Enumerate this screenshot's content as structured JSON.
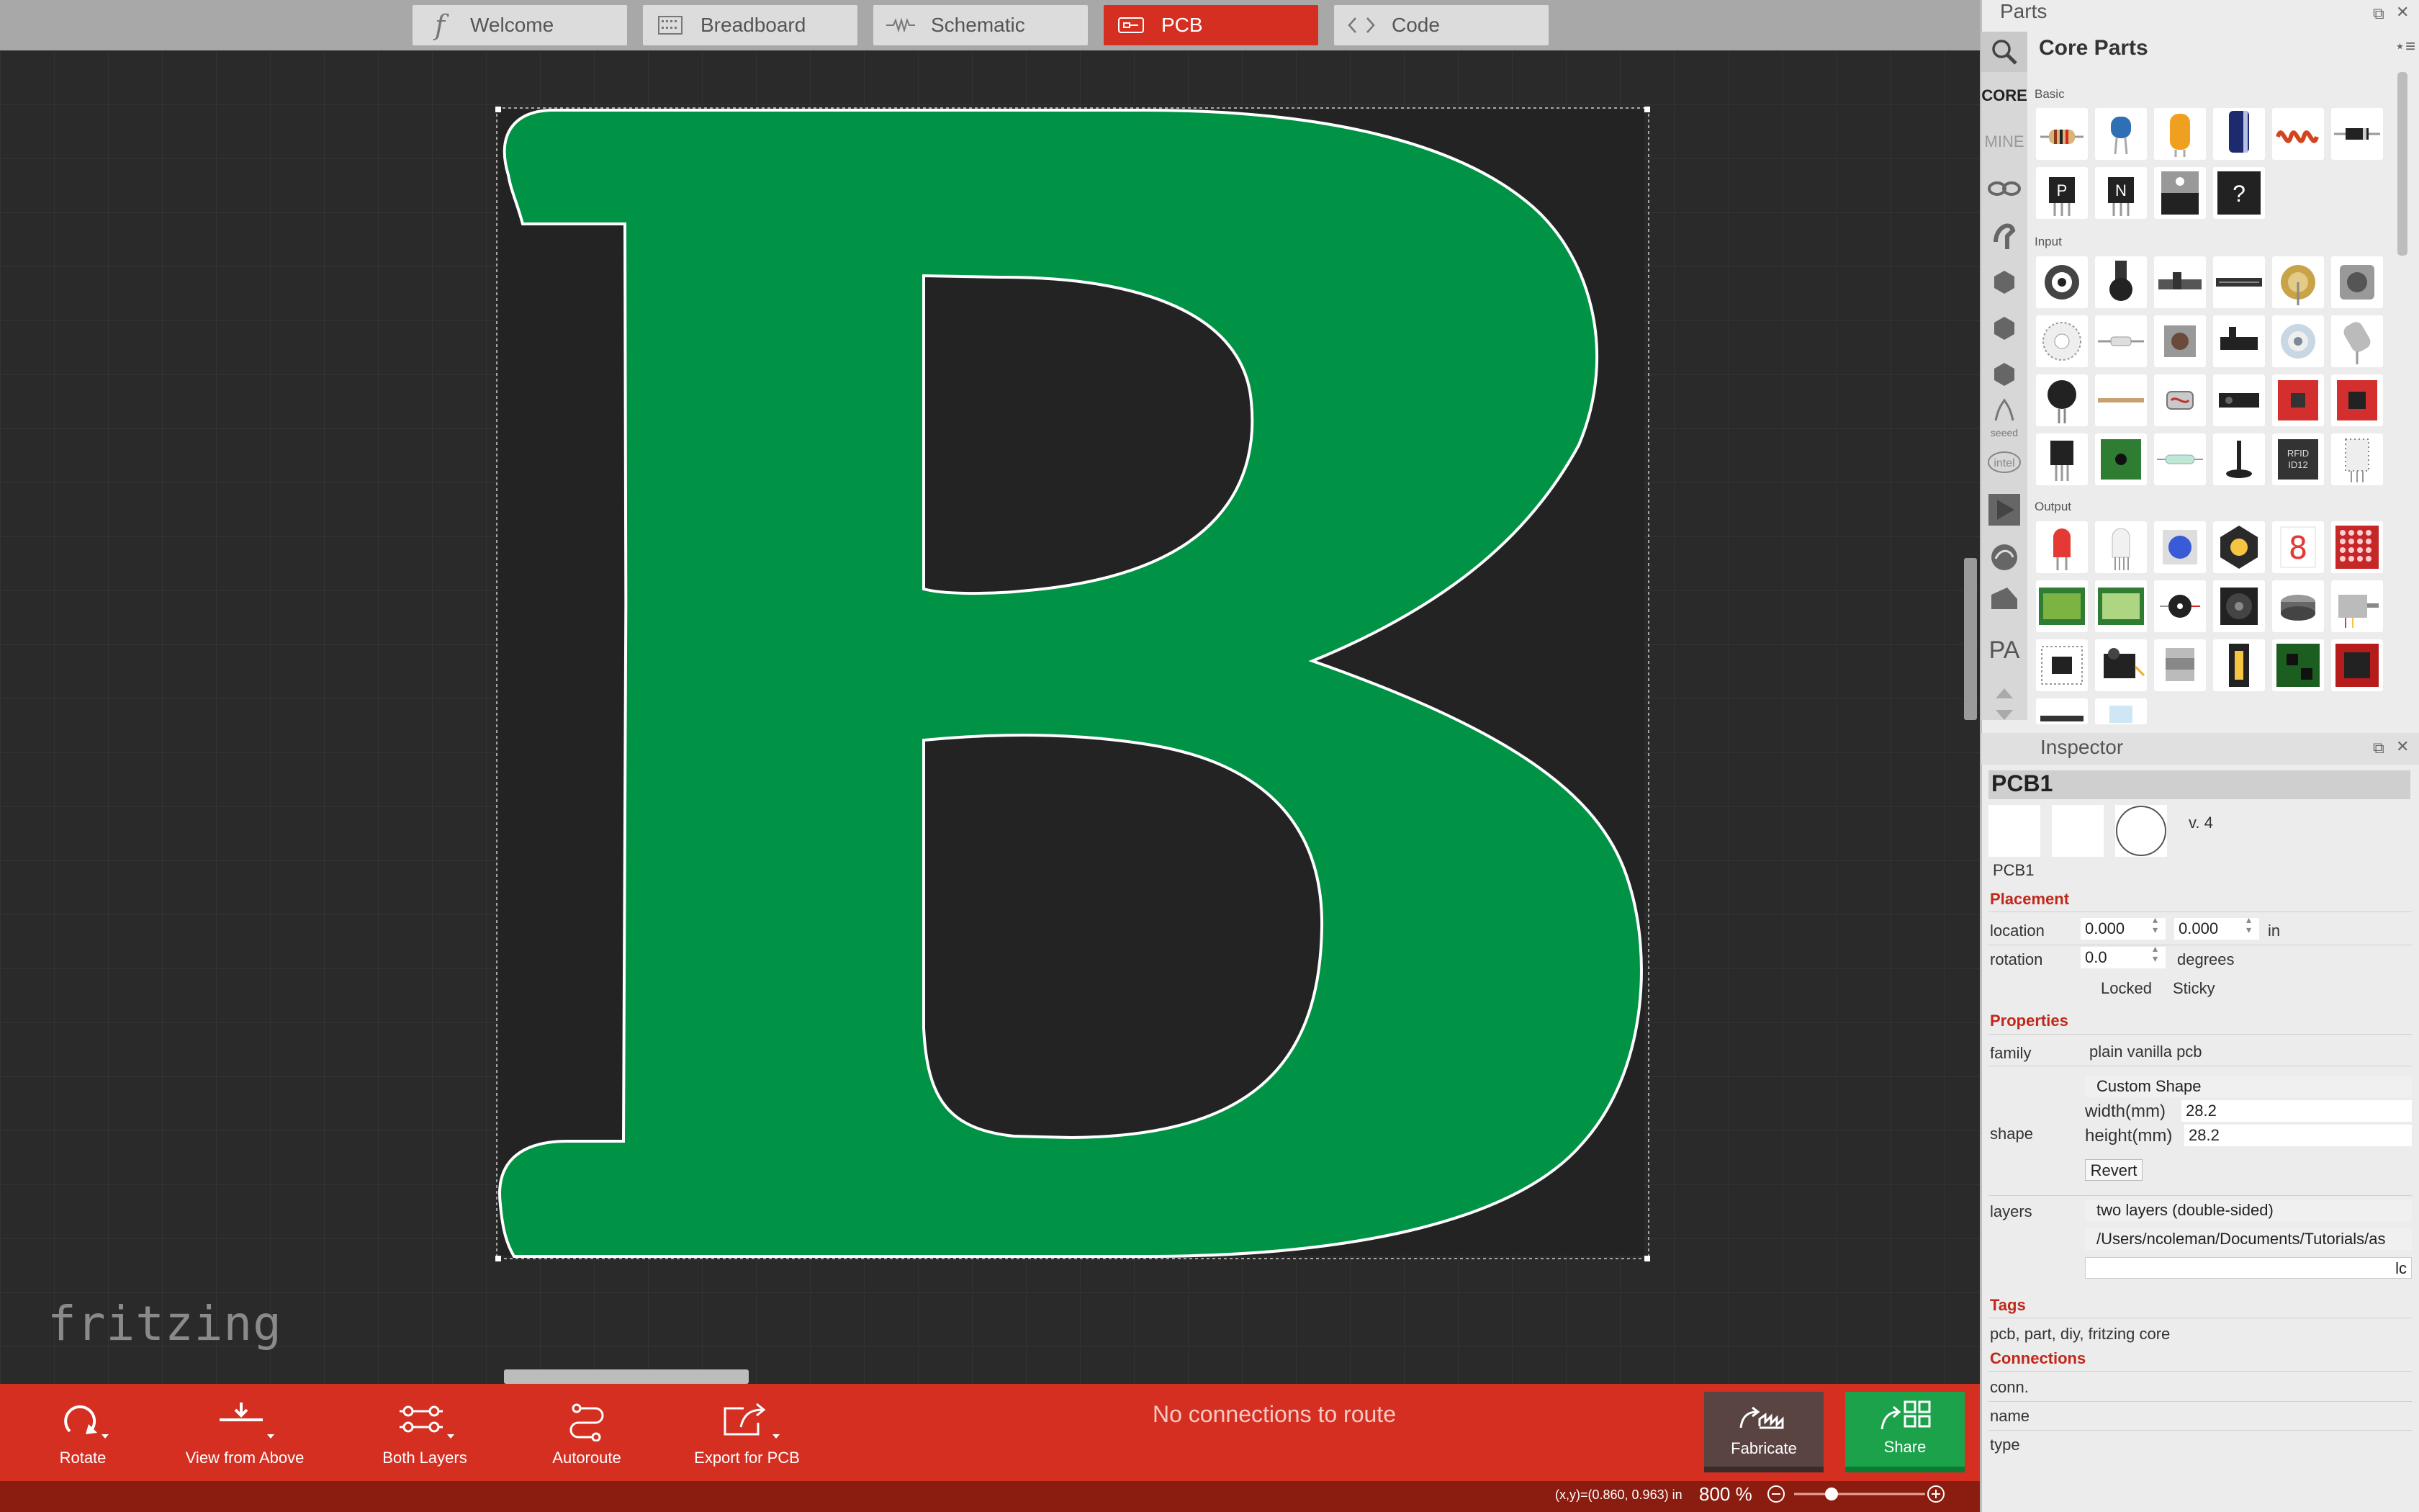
{
  "tabs": [
    {
      "label": "Welcome",
      "icon": "fritzing-f-icon",
      "active": false
    },
    {
      "label": "Breadboard",
      "icon": "breadboard-icon",
      "active": false
    },
    {
      "label": "Schematic",
      "icon": "schematic-wave-icon",
      "active": false
    },
    {
      "label": "PCB",
      "icon": "pcb-icon",
      "active": true
    },
    {
      "label": "Code",
      "icon": "code-brackets-icon",
      "active": false
    }
  ],
  "canvas": {
    "logo_text": "fritzing",
    "board_color": "#009245",
    "board_dark": "#222222"
  },
  "toolbar": {
    "rotate": "Rotate",
    "view_from_above": "View from Above",
    "both_layers": "Both Layers",
    "autoroute": "Autoroute",
    "export_for_pcb": "Export for PCB",
    "status_message": "No connections to route",
    "fabricate": "Fabricate",
    "share": "Share"
  },
  "statusbar": {
    "coords": "(x,y)=(0.860, 0.963) in",
    "zoom": "800 %"
  },
  "parts": {
    "title": "Parts",
    "bin_title": "Core Parts",
    "bin_tabs": [
      "CORE",
      "MINE"
    ],
    "sections": [
      "Basic",
      "Input",
      "Output"
    ]
  },
  "inspector": {
    "title": "Inspector",
    "part_title": "PCB1",
    "version": "v. 4",
    "instance": "PCB1",
    "placement_header": "Placement",
    "location_label": "location",
    "location_x": "0.000",
    "location_y": "0.000",
    "location_unit": "in",
    "rotation_label": "rotation",
    "rotation_value": "0.0",
    "rotation_unit": "degrees",
    "locked": "Locked",
    "sticky": "Sticky",
    "properties_header": "Properties",
    "family_label": "family",
    "family_value": "plain vanilla pcb",
    "shape_label": "shape",
    "shape_value": "Custom Shape",
    "width_label": "width(mm)",
    "width_value": "28.2",
    "height_label": "height(mm)",
    "height_value": "28.2",
    "revert": "Revert",
    "layers_label": "layers",
    "layers_value": "two layers (double-sided)",
    "file_path": "/Users/ncoleman/Documents/Tutorials/as",
    "file_field_tail": "lc",
    "tags_header": "Tags",
    "tags_value": "pcb, part, diy, fritzing core",
    "connections_header": "Connections",
    "conn_label": "conn.",
    "name_label": "name",
    "type_label": "type"
  }
}
